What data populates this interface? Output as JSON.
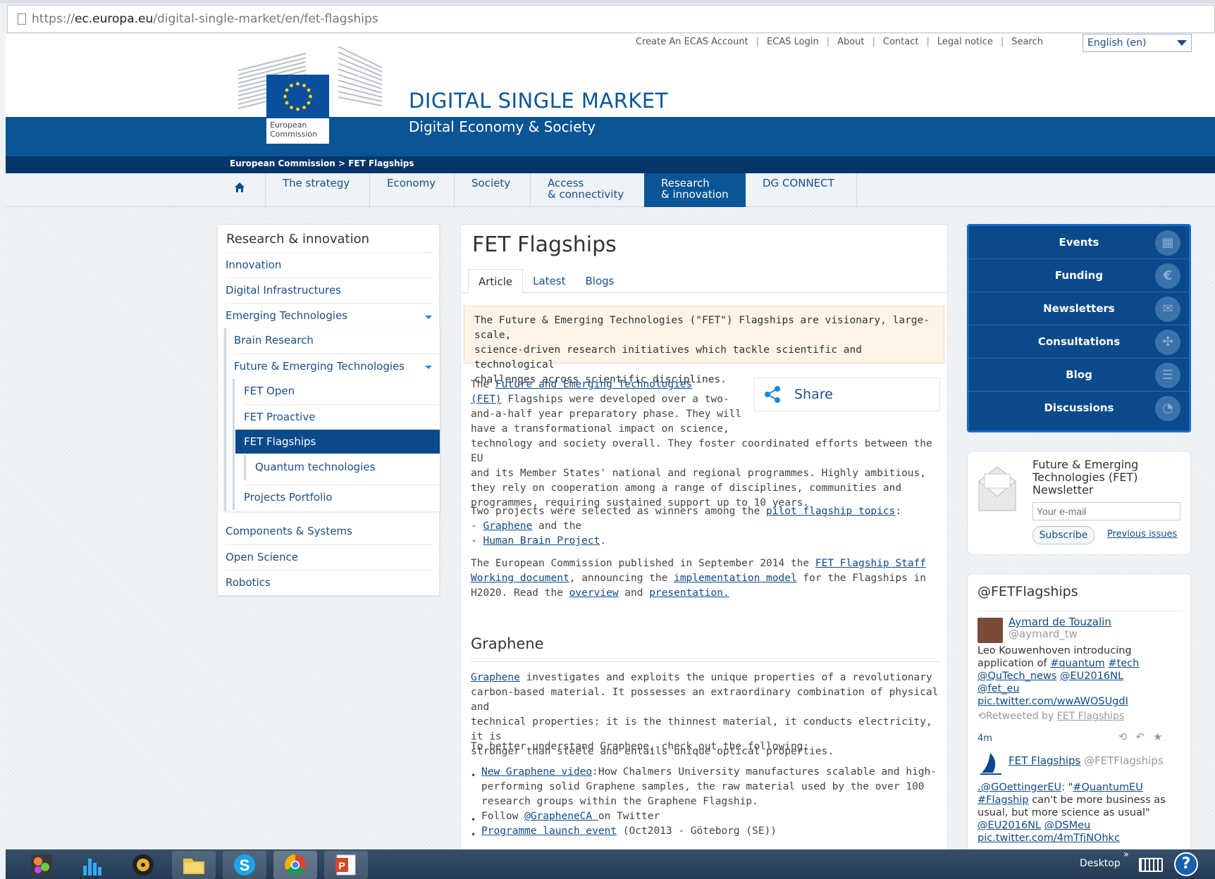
{
  "browser": {
    "url_prefix": "https://",
    "url_domain": "ec.europa.eu",
    "url_path": "/digital-single-market/en/fet-flagships"
  },
  "utility_links": [
    "Create An ECAS Account",
    "ECAS Login",
    "About",
    "Contact",
    "Legal notice",
    "Search"
  ],
  "language": "English (en)",
  "logo": {
    "line1": "European",
    "line2": "Commission"
  },
  "site": {
    "title": "DIGITAL SINGLE MARKET",
    "subtitle": "Digital Economy & Society"
  },
  "breadcrumb": "European Commission > FET Flagships",
  "nav": [
    {
      "l1": "The strategy",
      "l2": ""
    },
    {
      "l1": "Economy",
      "l2": ""
    },
    {
      "l1": "Society",
      "l2": ""
    },
    {
      "l1": "Access",
      "l2": "& connectivity"
    },
    {
      "l1": "Research",
      "l2": "& innovation"
    },
    {
      "l1": "DG CONNECT",
      "l2": ""
    }
  ],
  "sidebar": {
    "title": "Research & innovation",
    "items": [
      "Innovation",
      "Digital Infrastructures",
      "Emerging Technologies",
      "Brain Research",
      "Future & Emerging Technologies",
      "FET Open",
      "FET Proactive",
      "FET Flagships",
      "Quantum technologies",
      "Projects Portfolio",
      "Components & Systems",
      "Open Science",
      "Robotics"
    ]
  },
  "page": {
    "title": "FET Flagships",
    "tabs": [
      "Article",
      "Latest",
      "Blogs"
    ],
    "notice": [
      "The Future & Emerging Technologies (\"FET\") Flagships are visionary, large-scale,",
      "science-driven research initiatives which tackle scientific and technological",
      "challenges across scientific disciplines."
    ],
    "share": "Share",
    "p1_link": "Future and Emerging Technologies",
    "p1_link2": "(FET)",
    "p1": [
      "The",
      " Flagships were developed over a two-",
      "and-a-half year preparatory phase. They will",
      "have a transformational impact on science,",
      "technology and society overall. They foster coordinated efforts between the EU",
      "and its Member States' national and regional programmes. Highly ambitious,",
      "they rely on cooperation among a range of disciplines, communities and",
      "programmes, requiring sustained support up to 10 years."
    ],
    "p2": {
      "text": "Two projects were selected as winners among the ",
      "link": "pilot flagship topics",
      "colon": ":",
      "b1_pre": "- ",
      "b1": "Graphene",
      "b1_post": " and the",
      "b2_pre": "- ",
      "b2": "Human Brain Project",
      "b2_post": "."
    },
    "p3": {
      "t1": "The European Commission published in September 2014 the ",
      "l1": "FET Flagship Staff",
      "l1b": "Working document",
      "t2": ", announcing the ",
      "l2": "implementation model",
      "t3": " for the Flagships in",
      "t4": "H2020. Read the ",
      "l3": "overview",
      "t5": " and ",
      "l4": "presentation."
    },
    "h2": "Graphene",
    "g1_link": "Graphene",
    "g1": [
      " investigates and exploits the unique properties of a revolutionary",
      "carbon-based material. It possesses an extraordinary combination of physical and",
      "technical properties:  it is the thinnest material, it conducts electricity,  it is",
      "stronger than steele and entails unique optical properties."
    ],
    "g2": "To better understand Graphene, check out the following:",
    "bullets": {
      "b1_link": "New Graphene video",
      "b1": [
        ":How Chalmers University manufactures scalable and high-",
        "performing solid Graphene samples, the raw material used by the over 100",
        "research groups within the Graphene Flagship."
      ],
      "b2_pre": "Follow ",
      "b2_link": "@GrapheneCA ",
      "b2_post": "on Twitter",
      "b3_link": "Programme launch event",
      "b3_post": " (Oct2013 - Göteborg (SE))"
    }
  },
  "right_menu": [
    "Events",
    "Funding",
    "Newsletters",
    "Consultations",
    "Blog",
    "Discussions"
  ],
  "newsletter": {
    "title": [
      "Future & Emerging",
      "Technologies (FET)",
      "Newsletter"
    ],
    "placeholder": "Your e-mail",
    "subscribe": "Subscribe",
    "previous": "Previous issues"
  },
  "twitter": {
    "handle_title": "@FETFlagships",
    "t1_name": "Aymard de Touzalin",
    "t1_handle": "@aymard_tw",
    "t1_text": "Leo Kouwenhoven introducing",
    "t1_app": "application of ",
    "t1_tag1": "#quantum",
    "t1_tag2": "#tech",
    "t1_m1": "@QuTech_news",
    "t1_m2": "@EU2016NL",
    "t1_m3": "@fet_eu",
    "t1_pic": "pic.twitter.com/wwAWOSUgdI",
    "retweeted": "Retweeted by ",
    "retweeted_by": "FET Flagships",
    "time": "4m",
    "t2_name": "FET Flagships",
    "t2_handle": " @FETFlagships",
    "t2_m1": ".@GOettingerEU",
    "t2_q": ": \"",
    "t2_tag1": "#QuantumEU",
    "t2_tag2": "#Flagship",
    "t2_t1": " can't be more business as",
    "t2_t2": "usual, but more science as usual\"",
    "t2_m2": "@EU2016NL",
    "t2_m3": "@DSMeu",
    "t2_pic": "pic.twitter.com/4mTfjNOhkc"
  },
  "taskbar": {
    "desktop": "Desktop",
    "chevron": "»"
  }
}
